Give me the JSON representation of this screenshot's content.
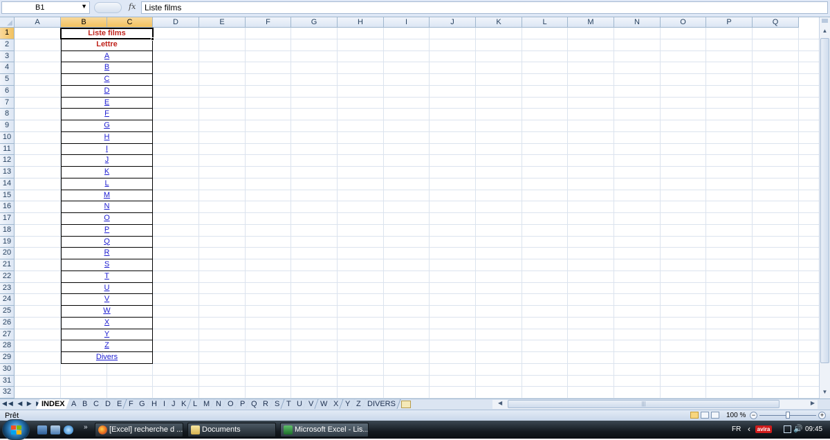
{
  "formula_bar": {
    "name_box": "B1",
    "fx_label": "fx",
    "formula": "Liste films"
  },
  "grid": {
    "columns": [
      "A",
      "B",
      "C",
      "D",
      "E",
      "F",
      "G",
      "H",
      "I",
      "J",
      "K",
      "L",
      "M",
      "N",
      "O",
      "P",
      "Q"
    ],
    "selected_column_labels": [
      "B",
      "C"
    ],
    "rows": [
      "1",
      "2",
      "3",
      "4",
      "5",
      "6",
      "7",
      "8",
      "9",
      "10",
      "11",
      "12",
      "13",
      "14",
      "15",
      "16",
      "17",
      "18",
      "19",
      "20",
      "21",
      "22",
      "23",
      "24",
      "25",
      "26",
      "27",
      "28",
      "29",
      "30",
      "31",
      "32"
    ],
    "selected_row": "1",
    "merged_bc": [
      {
        "row": "1",
        "text": "Liste films",
        "style": "title"
      },
      {
        "row": "2",
        "text": "Lettre",
        "style": "title"
      },
      {
        "row": "3",
        "text": "A",
        "style": "link"
      },
      {
        "row": "4",
        "text": "B",
        "style": "link"
      },
      {
        "row": "5",
        "text": "C",
        "style": "link"
      },
      {
        "row": "6",
        "text": "D",
        "style": "link"
      },
      {
        "row": "7",
        "text": "E",
        "style": "link"
      },
      {
        "row": "8",
        "text": "F",
        "style": "link"
      },
      {
        "row": "9",
        "text": "G",
        "style": "link"
      },
      {
        "row": "10",
        "text": "H",
        "style": "link"
      },
      {
        "row": "11",
        "text": "I",
        "style": "link"
      },
      {
        "row": "12",
        "text": "J",
        "style": "link"
      },
      {
        "row": "13",
        "text": "K",
        "style": "link"
      },
      {
        "row": "14",
        "text": "L",
        "style": "link"
      },
      {
        "row": "15",
        "text": "M",
        "style": "link"
      },
      {
        "row": "16",
        "text": "N",
        "style": "link"
      },
      {
        "row": "17",
        "text": "O",
        "style": "link"
      },
      {
        "row": "18",
        "text": "P",
        "style": "link"
      },
      {
        "row": "19",
        "text": "Q",
        "style": "link"
      },
      {
        "row": "20",
        "text": "R",
        "style": "link"
      },
      {
        "row": "21",
        "text": "S",
        "style": "link"
      },
      {
        "row": "22",
        "text": "T",
        "style": "link"
      },
      {
        "row": "23",
        "text": "U",
        "style": "link"
      },
      {
        "row": "24",
        "text": "V",
        "style": "link"
      },
      {
        "row": "25",
        "text": "W",
        "style": "link"
      },
      {
        "row": "26",
        "text": "X",
        "style": "link"
      },
      {
        "row": "27",
        "text": "Y",
        "style": "link"
      },
      {
        "row": "28",
        "text": "Z",
        "style": "link"
      },
      {
        "row": "29",
        "text": "Divers",
        "style": "link"
      }
    ]
  },
  "sheet_tabs": {
    "active": "INDEX",
    "tabs": [
      "INDEX",
      "A",
      "B",
      "C",
      "D",
      "E",
      "F",
      "G",
      "H",
      "I",
      "J",
      "K",
      "L",
      "M",
      "N",
      "O",
      "P",
      "Q",
      "R",
      "S",
      "T",
      "U",
      "V",
      "W",
      "X",
      "Y",
      "Z",
      "DIVERS"
    ]
  },
  "status_bar": {
    "status": "Prêt",
    "zoom": "100 %"
  },
  "taskbar": {
    "tasks": [
      {
        "label": "[Excel] recherche d ...",
        "icon": "firefox-icon"
      },
      {
        "label": "Documents",
        "icon": "folder-icon"
      },
      {
        "label": "Microsoft Excel - Lis...",
        "icon": "excel-icon",
        "active": true
      }
    ],
    "language": "FR",
    "antivirus": "avira",
    "clock": "09:45"
  },
  "colors": {
    "title_red": "#c0241c",
    "link_blue": "#1b1bd0",
    "selection_orange": "#f1c15f"
  }
}
